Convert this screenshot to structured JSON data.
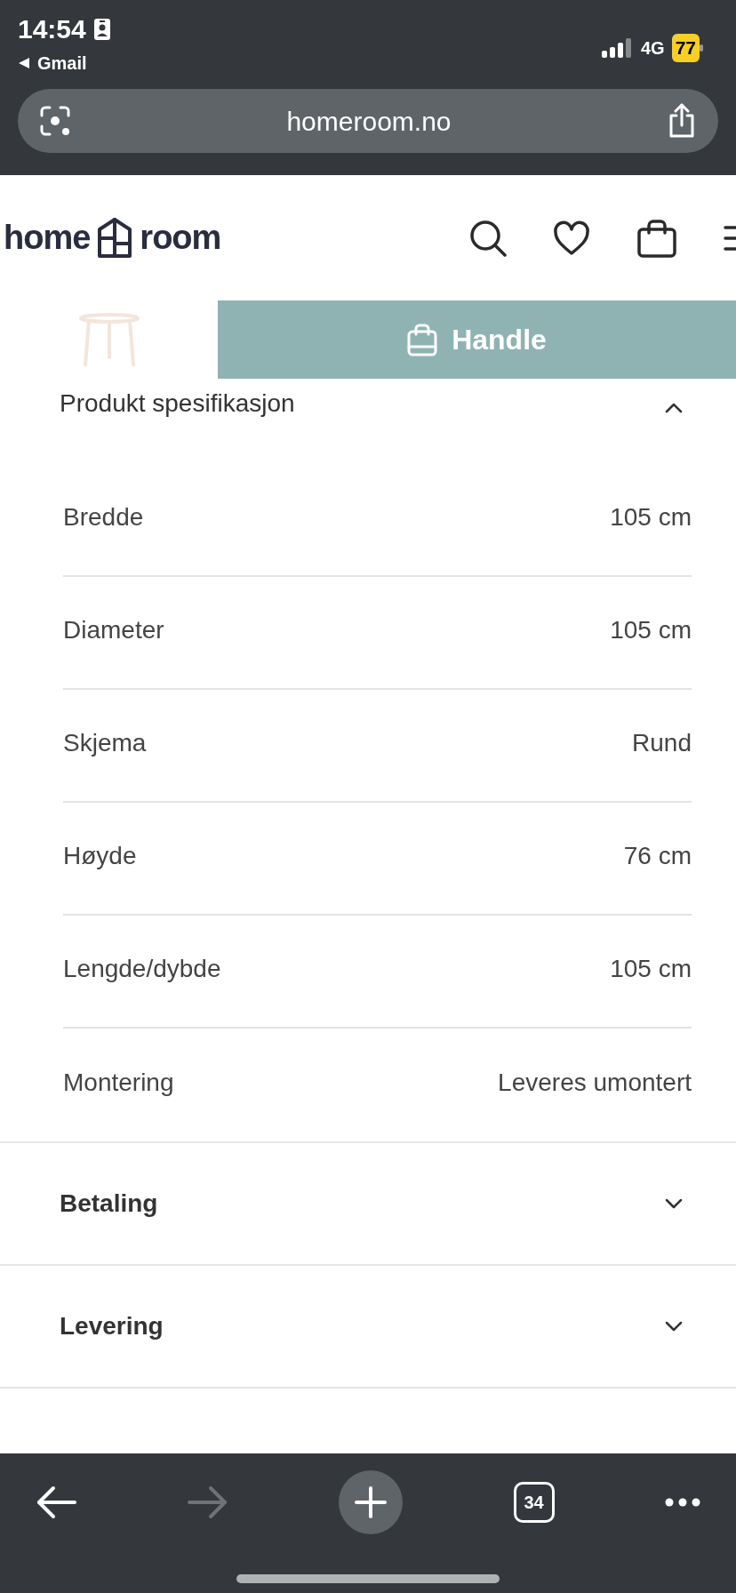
{
  "status_bar": {
    "time": "14:54",
    "back_app": "Gmail",
    "network": "4G",
    "battery": "77"
  },
  "address_bar": {
    "url": "homeroom.no"
  },
  "site_header": {
    "logo_left": "home",
    "logo_right": "room"
  },
  "sticky_bar": {
    "buy_button": "Handle"
  },
  "sections": [
    {
      "title": "Produkt spesifikasjon",
      "expanded": true,
      "specs": [
        {
          "label": "Bredde",
          "value": "105 cm"
        },
        {
          "label": "Diameter",
          "value": "105 cm"
        },
        {
          "label": "Skjema",
          "value": "Rund"
        },
        {
          "label": "Høyde",
          "value": "76 cm"
        },
        {
          "label": "Lengde/dybde",
          "value": "105 cm"
        },
        {
          "label": "Montering",
          "value": "Leveres umontert"
        }
      ]
    },
    {
      "title": "Betaling",
      "expanded": false
    },
    {
      "title": "Levering",
      "expanded": false
    }
  ],
  "toolbar": {
    "back_disabled": false,
    "forward_disabled": true,
    "tab_count": "34"
  }
}
